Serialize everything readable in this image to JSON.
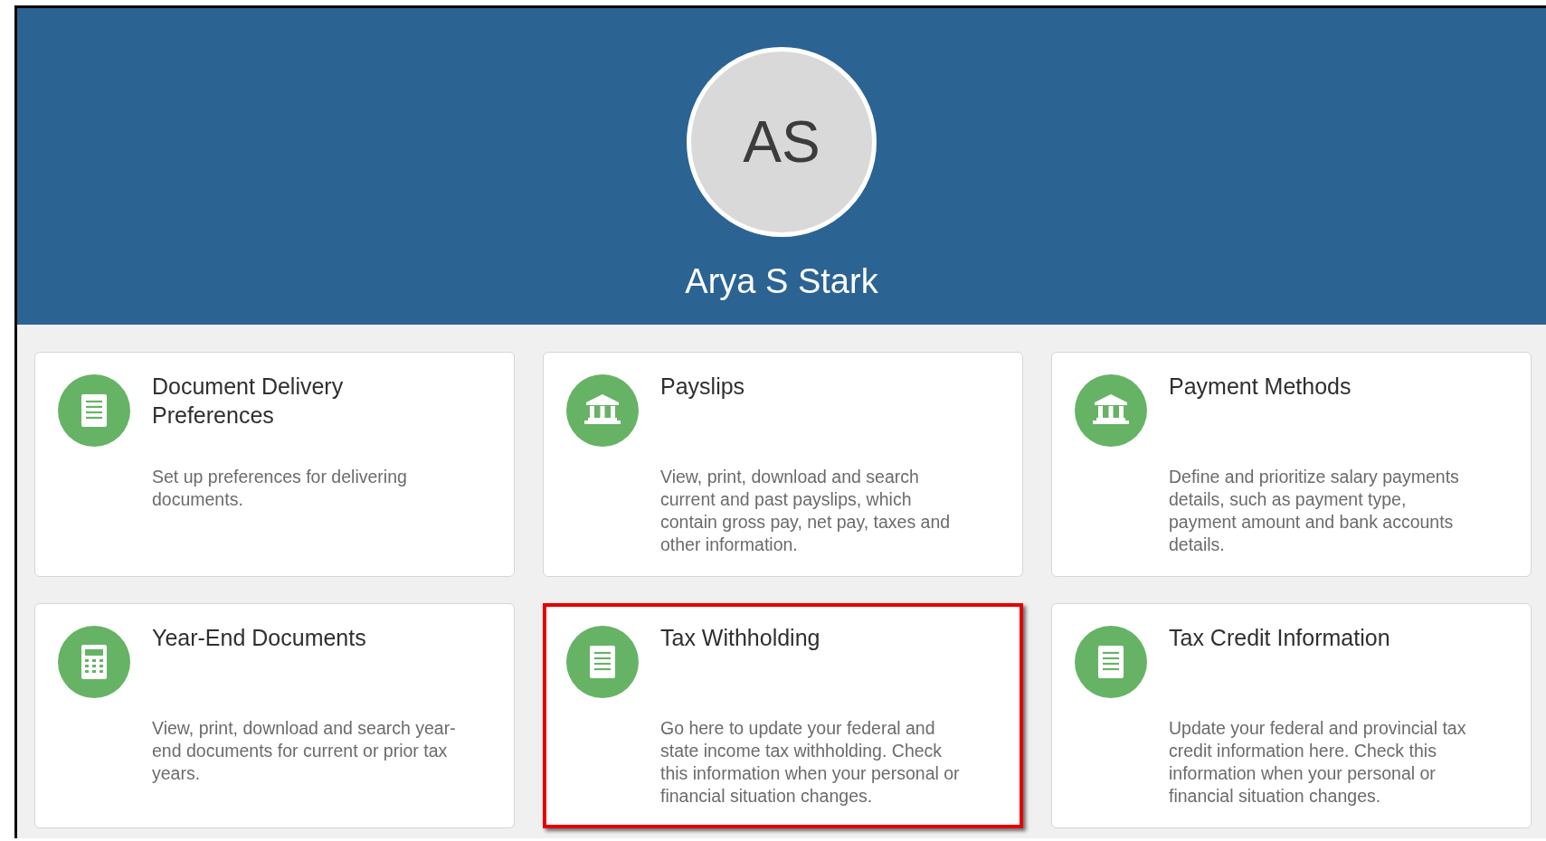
{
  "profile": {
    "initials": "AS",
    "name": "Arya S Stark"
  },
  "cards": [
    {
      "kind": "document",
      "title": "Document Delivery Preferences",
      "description": "Set up preferences for delivering documents.",
      "highlighted": false
    },
    {
      "kind": "bank",
      "title": "Payslips",
      "description": "View, print, download and search current and past payslips, which contain gross pay, net pay, taxes and other information.",
      "highlighted": false
    },
    {
      "kind": "bank",
      "title": "Payment Methods",
      "description": "Define and prioritize salary payments details, such as payment type, payment amount and bank accounts details.",
      "highlighted": false
    },
    {
      "kind": "calculator",
      "title": "Year-End Documents",
      "description": "View, print, download and search year-end documents for current or prior tax years.",
      "highlighted": false
    },
    {
      "kind": "document",
      "title": "Tax Withholding",
      "description": "Go here to update your federal and state income tax withholding. Check this information when your personal or financial situation changes.",
      "highlighted": true
    },
    {
      "kind": "document",
      "title": "Tax Credit Information",
      "description": "Update your federal and provincial tax credit information here. Check this information when your personal or financial situation changes.",
      "highlighted": false
    }
  ]
}
